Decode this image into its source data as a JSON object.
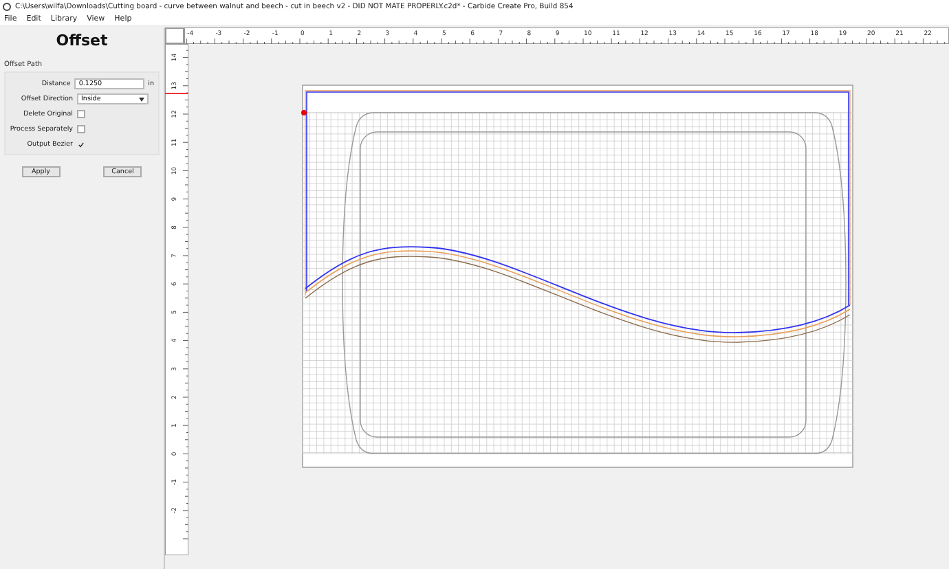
{
  "window": {
    "title": "C:\\Users\\wilfa\\Downloads\\Cutting board - curve between walnut and beech - cut in beech v2 - DID NOT MATE PROPERLY.c2d* - Carbide Create Pro, Build 854"
  },
  "menu": [
    "File",
    "Edit",
    "Library",
    "View",
    "Help"
  ],
  "offset_panel": {
    "title": "Offset",
    "group": "Offset Path",
    "fields": [
      {
        "kind": "text",
        "label": "Distance",
        "value": "0.1250",
        "unit": "in"
      },
      {
        "kind": "select",
        "label": "Offset Direction",
        "value": "Inside"
      },
      {
        "kind": "checkbox",
        "label": "Delete Original",
        "checked": false
      },
      {
        "kind": "checkbox",
        "label": "Process Separately",
        "checked": false
      },
      {
        "kind": "checkbox",
        "label": "Output Bezier",
        "checked": true
      }
    ],
    "buttons": [
      "Apply",
      "Cancel"
    ]
  },
  "rulers": {
    "horizontal": [
      "-4",
      "-3",
      "-2",
      "-1",
      "0",
      "1",
      "2",
      "3",
      "4",
      "5",
      "6",
      "7",
      "8",
      "9",
      "10",
      "11",
      "12",
      "13",
      "14",
      "15",
      "16",
      "17",
      "18",
      "19",
      "20",
      "21",
      "22"
    ],
    "vertical": [
      "14",
      "13",
      "12",
      "11",
      "10",
      "9",
      "8",
      "7",
      "6",
      "5",
      "4",
      "3",
      "2",
      "1",
      "0",
      "-1",
      "-2"
    ]
  }
}
